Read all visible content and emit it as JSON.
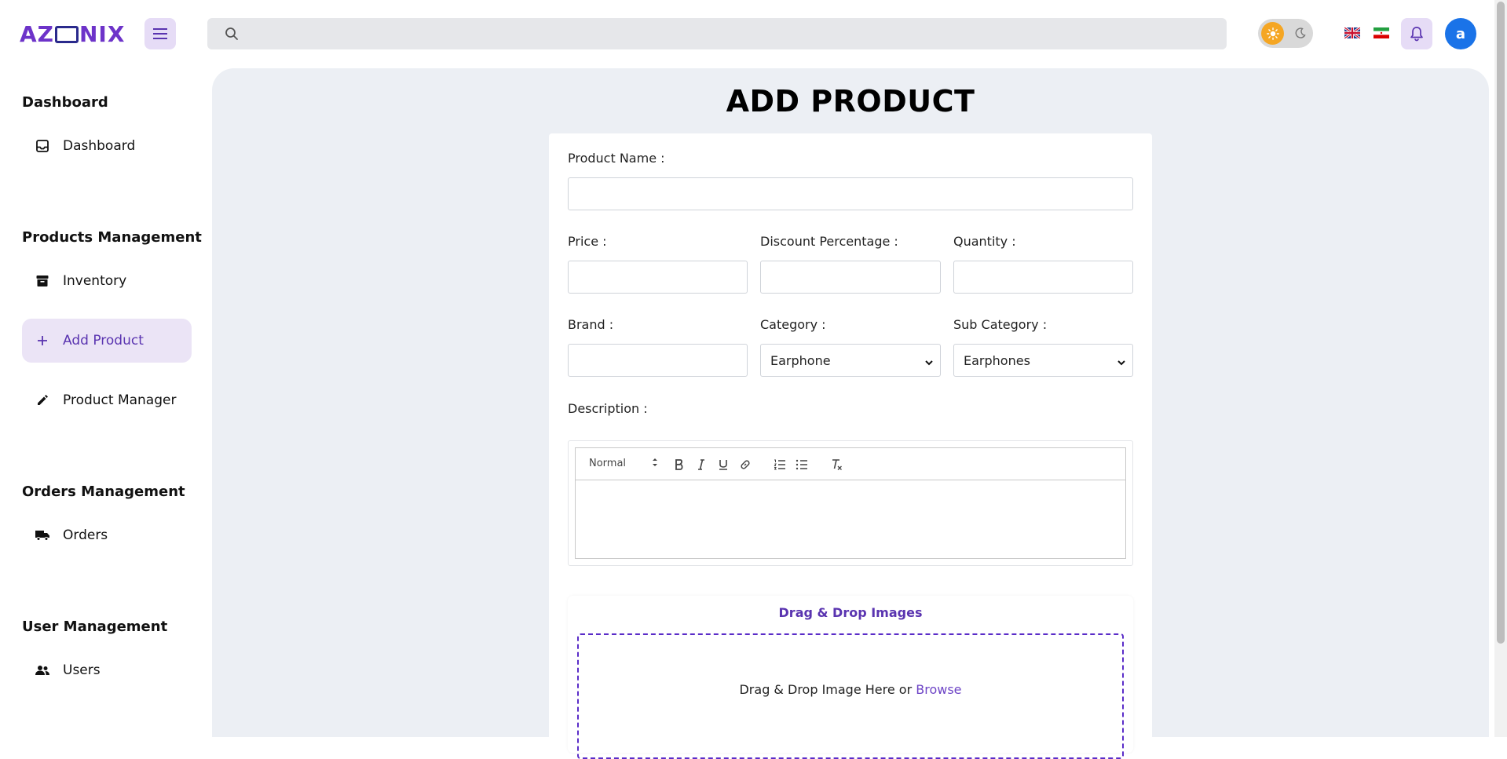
{
  "header": {
    "logo_left": "AZ",
    "logo_right": "NIX",
    "avatar_letter": "a",
    "search_placeholder": ""
  },
  "sidebar": {
    "sections": [
      {
        "title": "Dashboard",
        "items": [
          {
            "label": "Dashboard",
            "icon": "inbox-icon"
          }
        ]
      },
      {
        "title": "Products Management",
        "items": [
          {
            "label": "Inventory",
            "icon": "archive-icon"
          },
          {
            "label": "Add Product",
            "icon": "plus-icon",
            "active": true
          },
          {
            "label": "Product Manager",
            "icon": "pencil-icon"
          }
        ]
      },
      {
        "title": "Orders Management",
        "items": [
          {
            "label": "Orders",
            "icon": "truck-icon"
          }
        ]
      },
      {
        "title": "User Management",
        "items": [
          {
            "label": "Users",
            "icon": "users-icon"
          }
        ]
      }
    ]
  },
  "main": {
    "title": "ADD PRODUCT",
    "form": {
      "product_name_label": "Product Name :",
      "price_label": "Price :",
      "discount_label": "Discount Percentage :",
      "quantity_label": "Quantity :",
      "brand_label": "Brand :",
      "category_label": "Category :",
      "category_value": "Earphone",
      "subcategory_label": "Sub Category :",
      "subcategory_value": "Earphones",
      "description_label": "Description :",
      "editor_format": "Normal"
    },
    "upload": {
      "title": "Drag & Drop Images",
      "text": "Drag & Drop Image Here or ",
      "browse": "Browse"
    }
  },
  "colors": {
    "accent": "#5a34b0",
    "sidebar_active_bg": "#ebe4f6",
    "main_bg": "#eceff4",
    "avatar_bg": "#1a73e8",
    "sun": "#f5a623"
  }
}
